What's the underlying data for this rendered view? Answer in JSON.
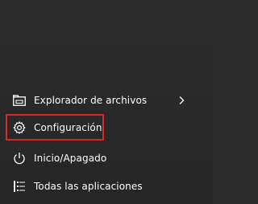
{
  "start_menu": {
    "items": [
      {
        "label": "Explorador de archivos",
        "icon": "file-explorer-icon",
        "has_submenu": true
      },
      {
        "label": "Configuración",
        "icon": "gear-icon",
        "highlighted": true
      },
      {
        "label": "Inicio/Apagado",
        "icon": "power-icon"
      },
      {
        "label": "Todas las aplicaciones",
        "icon": "all-apps-icon"
      }
    ],
    "highlight_color": "#d9262c",
    "background_color": "#2b2b2b"
  }
}
